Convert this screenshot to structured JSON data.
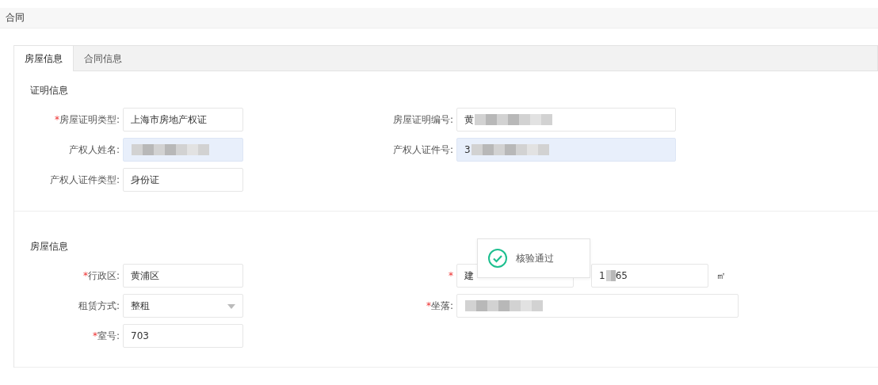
{
  "header": {
    "title": "合同"
  },
  "tabs": [
    {
      "label": "房屋信息",
      "selected": true
    },
    {
      "label": "合同信息",
      "selected": false
    }
  ],
  "sections": [
    {
      "title": "证明信息",
      "rows": [
        [
          {
            "mark": "*",
            "label": "房屋证明类型:",
            "value": "上海市房地产权证",
            "redacted": false,
            "highlighted": false
          },
          {
            "label": "房屋证明编号:",
            "value": "黄",
            "redacted": true,
            "highlighted": false
          }
        ],
        [
          {
            "label": "产权人姓名:",
            "redacted": true,
            "highlighted": true
          },
          {
            "label": "产权人证件号:",
            "value": "3",
            "redacted": true,
            "highlighted": true
          }
        ],
        [
          {
            "label": "产权人证件类型:",
            "value": "身份证",
            "redacted": false,
            "highlighted": false
          }
        ]
      ]
    },
    {
      "title": "房屋信息",
      "rows": [
        [
          {
            "mark": "*",
            "label": "行政区:",
            "value": "黄浦区",
            "redacted": false,
            "highlighted": false
          },
          {
            "kind": "area",
            "mark": "*",
            "value": "建",
            "area_value": "1",
            "area_value_after": "65",
            "redacted": true,
            "unit": "㎡"
          }
        ],
        [
          {
            "kind": "select",
            "label": "租赁方式:",
            "value": "整租"
          },
          {
            "mark": "*",
            "label": "坐落:",
            "redacted": true,
            "highlighted": false
          }
        ],
        [
          {
            "mark": "*",
            "label": "室号:",
            "value": "703",
            "redacted": false,
            "highlighted": false
          }
        ]
      ]
    }
  ],
  "toast": {
    "message": "核验通过"
  }
}
